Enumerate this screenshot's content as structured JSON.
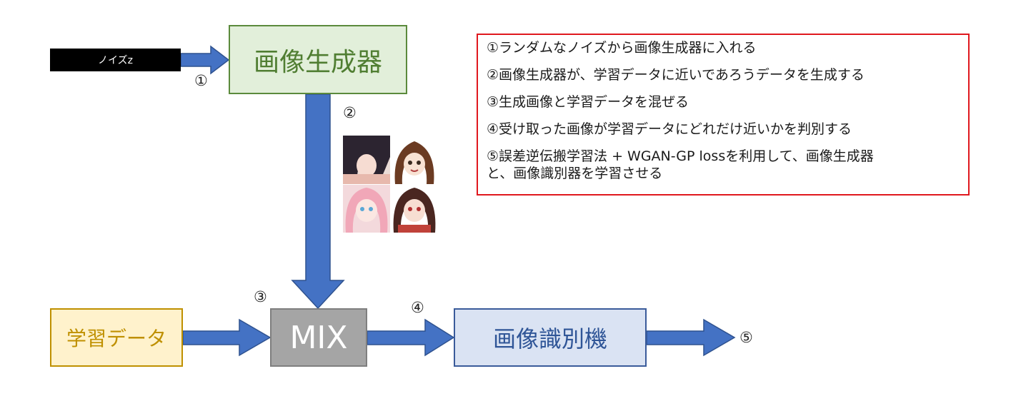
{
  "noise": {
    "label": "ノイズz"
  },
  "generator": {
    "label": "画像生成器"
  },
  "training_data": {
    "label": "学習データ"
  },
  "mix": {
    "label": "MIX"
  },
  "discriminator": {
    "label": "画像識別機"
  },
  "steps": [
    "①",
    "②",
    "③",
    "④",
    "⑤"
  ],
  "legend": {
    "lines": [
      "①ランダムなノイズから画像生成器に入れる",
      "②画像生成器が、学習データに近いであろうデータを生成する",
      "③生成画像と学習データを混ぜる",
      "④受け取った画像が学習データにどれだけ近いかを判別する",
      "⑤誤差逆伝搬学習法 + WGAN-GP lossを利用して、画像生成器",
      "と、画像識別器を学習させる"
    ]
  },
  "colors": {
    "arrow": "#4472c4",
    "arrow_outline": "#2f528f",
    "legend_border": "#e0181e"
  }
}
